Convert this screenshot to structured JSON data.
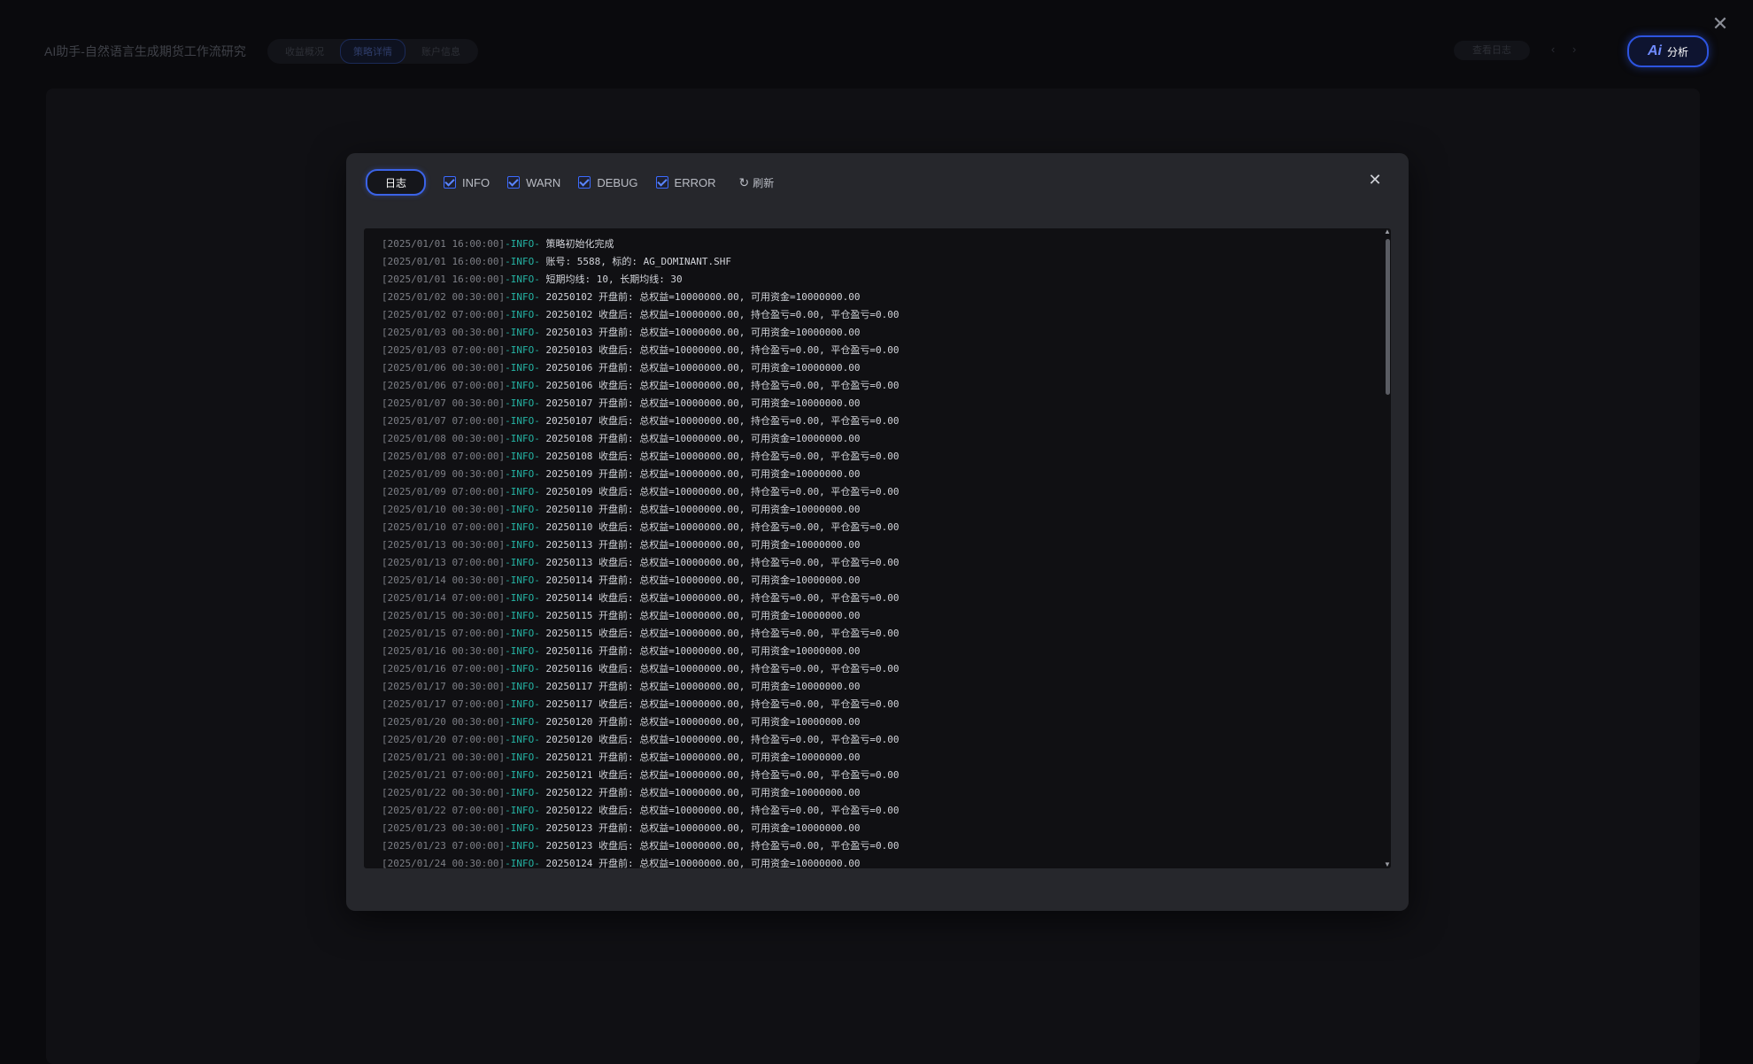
{
  "app": {
    "title": "AI助手-自然语言生成期货工作流研究",
    "tabs": [
      "收益概况",
      "策略详情",
      "账户信息"
    ],
    "header_button": "查看日志",
    "prev_icon": "‹",
    "next_icon": "›",
    "ai_mark": "Ai",
    "ai_label": "分析",
    "close_glyph": "✕"
  },
  "modal": {
    "tab_label": "日志",
    "filters": [
      {
        "label": "INFO",
        "checked": true
      },
      {
        "label": "WARN",
        "checked": true
      },
      {
        "label": "DEBUG",
        "checked": true
      },
      {
        "label": "ERROR",
        "checked": true
      }
    ],
    "refresh_label": "刷新",
    "refresh_icon": "↻",
    "close_glyph": "✕",
    "logs": [
      {
        "time": "[2025/01/01 16:00:00]",
        "level": "-INFO-",
        "msg": "策略初始化完成"
      },
      {
        "time": "[2025/01/01 16:00:00]",
        "level": "-INFO-",
        "msg": "账号: 5588, 标的: AG_DOMINANT.SHF"
      },
      {
        "time": "[2025/01/01 16:00:00]",
        "level": "-INFO-",
        "msg": "短期均线: 10, 长期均线: 30"
      },
      {
        "time": "[2025/01/02 00:30:00]",
        "level": "-INFO-",
        "msg": "20250102 开盘前: 总权益=10000000.00, 可用资金=10000000.00"
      },
      {
        "time": "[2025/01/02 07:00:00]",
        "level": "-INFO-",
        "msg": "20250102 收盘后: 总权益=10000000.00, 持仓盈亏=0.00, 平仓盈亏=0.00"
      },
      {
        "time": "[2025/01/03 00:30:00]",
        "level": "-INFO-",
        "msg": "20250103 开盘前: 总权益=10000000.00, 可用资金=10000000.00"
      },
      {
        "time": "[2025/01/03 07:00:00]",
        "level": "-INFO-",
        "msg": "20250103 收盘后: 总权益=10000000.00, 持仓盈亏=0.00, 平仓盈亏=0.00"
      },
      {
        "time": "[2025/01/06 00:30:00]",
        "level": "-INFO-",
        "msg": "20250106 开盘前: 总权益=10000000.00, 可用资金=10000000.00"
      },
      {
        "time": "[2025/01/06 07:00:00]",
        "level": "-INFO-",
        "msg": "20250106 收盘后: 总权益=10000000.00, 持仓盈亏=0.00, 平仓盈亏=0.00"
      },
      {
        "time": "[2025/01/07 00:30:00]",
        "level": "-INFO-",
        "msg": "20250107 开盘前: 总权益=10000000.00, 可用资金=10000000.00"
      },
      {
        "time": "[2025/01/07 07:00:00]",
        "level": "-INFO-",
        "msg": "20250107 收盘后: 总权益=10000000.00, 持仓盈亏=0.00, 平仓盈亏=0.00"
      },
      {
        "time": "[2025/01/08 00:30:00]",
        "level": "-INFO-",
        "msg": "20250108 开盘前: 总权益=10000000.00, 可用资金=10000000.00"
      },
      {
        "time": "[2025/01/08 07:00:00]",
        "level": "-INFO-",
        "msg": "20250108 收盘后: 总权益=10000000.00, 持仓盈亏=0.00, 平仓盈亏=0.00"
      },
      {
        "time": "[2025/01/09 00:30:00]",
        "level": "-INFO-",
        "msg": "20250109 开盘前: 总权益=10000000.00, 可用资金=10000000.00"
      },
      {
        "time": "[2025/01/09 07:00:00]",
        "level": "-INFO-",
        "msg": "20250109 收盘后: 总权益=10000000.00, 持仓盈亏=0.00, 平仓盈亏=0.00"
      },
      {
        "time": "[2025/01/10 00:30:00]",
        "level": "-INFO-",
        "msg": "20250110 开盘前: 总权益=10000000.00, 可用资金=10000000.00"
      },
      {
        "time": "[2025/01/10 07:00:00]",
        "level": "-INFO-",
        "msg": "20250110 收盘后: 总权益=10000000.00, 持仓盈亏=0.00, 平仓盈亏=0.00"
      },
      {
        "time": "[2025/01/13 00:30:00]",
        "level": "-INFO-",
        "msg": "20250113 开盘前: 总权益=10000000.00, 可用资金=10000000.00"
      },
      {
        "time": "[2025/01/13 07:00:00]",
        "level": "-INFO-",
        "msg": "20250113 收盘后: 总权益=10000000.00, 持仓盈亏=0.00, 平仓盈亏=0.00"
      },
      {
        "time": "[2025/01/14 00:30:00]",
        "level": "-INFO-",
        "msg": "20250114 开盘前: 总权益=10000000.00, 可用资金=10000000.00"
      },
      {
        "time": "[2025/01/14 07:00:00]",
        "level": "-INFO-",
        "msg": "20250114 收盘后: 总权益=10000000.00, 持仓盈亏=0.00, 平仓盈亏=0.00"
      },
      {
        "time": "[2025/01/15 00:30:00]",
        "level": "-INFO-",
        "msg": "20250115 开盘前: 总权益=10000000.00, 可用资金=10000000.00"
      },
      {
        "time": "[2025/01/15 07:00:00]",
        "level": "-INFO-",
        "msg": "20250115 收盘后: 总权益=10000000.00, 持仓盈亏=0.00, 平仓盈亏=0.00"
      },
      {
        "time": "[2025/01/16 00:30:00]",
        "level": "-INFO-",
        "msg": "20250116 开盘前: 总权益=10000000.00, 可用资金=10000000.00"
      },
      {
        "time": "[2025/01/16 07:00:00]",
        "level": "-INFO-",
        "msg": "20250116 收盘后: 总权益=10000000.00, 持仓盈亏=0.00, 平仓盈亏=0.00"
      },
      {
        "time": "[2025/01/17 00:30:00]",
        "level": "-INFO-",
        "msg": "20250117 开盘前: 总权益=10000000.00, 可用资金=10000000.00"
      },
      {
        "time": "[2025/01/17 07:00:00]",
        "level": "-INFO-",
        "msg": "20250117 收盘后: 总权益=10000000.00, 持仓盈亏=0.00, 平仓盈亏=0.00"
      },
      {
        "time": "[2025/01/20 00:30:00]",
        "level": "-INFO-",
        "msg": "20250120 开盘前: 总权益=10000000.00, 可用资金=10000000.00"
      },
      {
        "time": "[2025/01/20 07:00:00]",
        "level": "-INFO-",
        "msg": "20250120 收盘后: 总权益=10000000.00, 持仓盈亏=0.00, 平仓盈亏=0.00"
      },
      {
        "time": "[2025/01/21 00:30:00]",
        "level": "-INFO-",
        "msg": "20250121 开盘前: 总权益=10000000.00, 可用资金=10000000.00"
      },
      {
        "time": "[2025/01/21 07:00:00]",
        "level": "-INFO-",
        "msg": "20250121 收盘后: 总权益=10000000.00, 持仓盈亏=0.00, 平仓盈亏=0.00"
      },
      {
        "time": "[2025/01/22 00:30:00]",
        "level": "-INFO-",
        "msg": "20250122 开盘前: 总权益=10000000.00, 可用资金=10000000.00"
      },
      {
        "time": "[2025/01/22 07:00:00]",
        "level": "-INFO-",
        "msg": "20250122 收盘后: 总权益=10000000.00, 持仓盈亏=0.00, 平仓盈亏=0.00"
      },
      {
        "time": "[2025/01/23 00:30:00]",
        "level": "-INFO-",
        "msg": "20250123 开盘前: 总权益=10000000.00, 可用资金=10000000.00"
      },
      {
        "time": "[2025/01/23 07:00:00]",
        "level": "-INFO-",
        "msg": "20250123 收盘后: 总权益=10000000.00, 持仓盈亏=0.00, 平仓盈亏=0.00"
      },
      {
        "time": "[2025/01/24 00:30:00]",
        "level": "-INFO-",
        "msg": "20250124 开盘前: 总权益=10000000.00, 可用资金=10000000.00"
      }
    ]
  },
  "colors": {
    "accent": "#3b63e6",
    "info_level": "#25b4a4",
    "modal_bg": "#26272c",
    "log_bg": "#101013"
  },
  "icons": {
    "page_close": "close-icon",
    "modal_close": "close-icon",
    "refresh": "refresh-icon",
    "checkbox": "checkbox-checked-icon"
  }
}
